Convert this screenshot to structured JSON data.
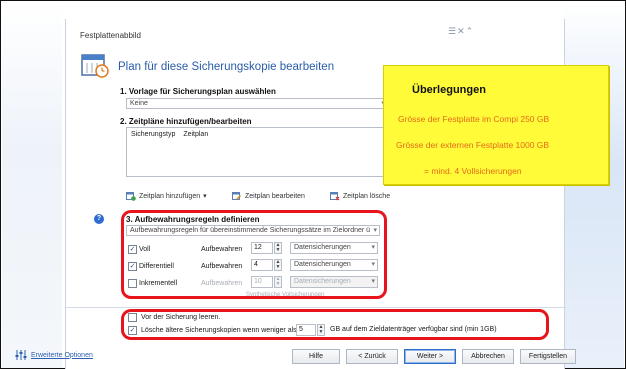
{
  "window": {
    "title": "Festplattenabbild",
    "controls": "☰✕⌃"
  },
  "heading": "Plan für diese Sicherungskopie bearbeiten",
  "step1": {
    "label": "1. Vorlage für Sicherungsplan auswählen",
    "value": "Keine"
  },
  "step2": {
    "label": "2. Zeitpläne hinzufügen/bearbeiten",
    "columns": [
      "Sicherungstyp",
      "Zeitplan"
    ],
    "add_label": "Zeitplan hinzufügen",
    "edit_label": "Zeitplan bearbeiten",
    "delete_label": "Zeitplan lösche"
  },
  "step3": {
    "label": "3. Aufbewahrungsregeln definieren",
    "rule_select": "Aufbewahrungsregeln für übereinstimmende Sicherungssätze im Zielordner ü",
    "rows": [
      {
        "name": "Voll",
        "checked": true,
        "keep_label": "Aufbewahren",
        "count": "12",
        "unit": "Datensicherungen"
      },
      {
        "name": "Differentiell",
        "checked": true,
        "keep_label": "Aufbewahren",
        "count": "4",
        "unit": "Datensicherungen"
      },
      {
        "name": "Inkrementell",
        "checked": false,
        "keep_label": "Aufbewahren",
        "count": "10",
        "unit": "Datensicherungen"
      }
    ],
    "faded_text": "Synthetische Vollsicherungen"
  },
  "options": {
    "before_backup": "Vor der Sicherung leeren.",
    "delete_older": "Lösche ältere Sicherungskopien wenn weniger als",
    "gb_value": "5",
    "gb_suffix": "GB auf dem Zieldatenträger verfügbar sind (min 1GB)"
  },
  "footer": {
    "advanced": "Erweiterte Optionen",
    "help": "Hilfe",
    "back": "< Zurück",
    "next": "Weiter >",
    "cancel": "Abbrechen",
    "finish": "Fertigstellen"
  },
  "note": {
    "title": "Überlegungen",
    "line1": "Grösse der Festplatte im Compi 250 GB",
    "line2": "Grösse der externen Festplatte 1000 GB",
    "line3": "= mind. 4 Vollsicherungen"
  },
  "colors": {
    "accent": "#2a5da8",
    "highlight_border": "#e8141c",
    "note_bg": "#fffb38",
    "note_text": "#e46b1a"
  }
}
